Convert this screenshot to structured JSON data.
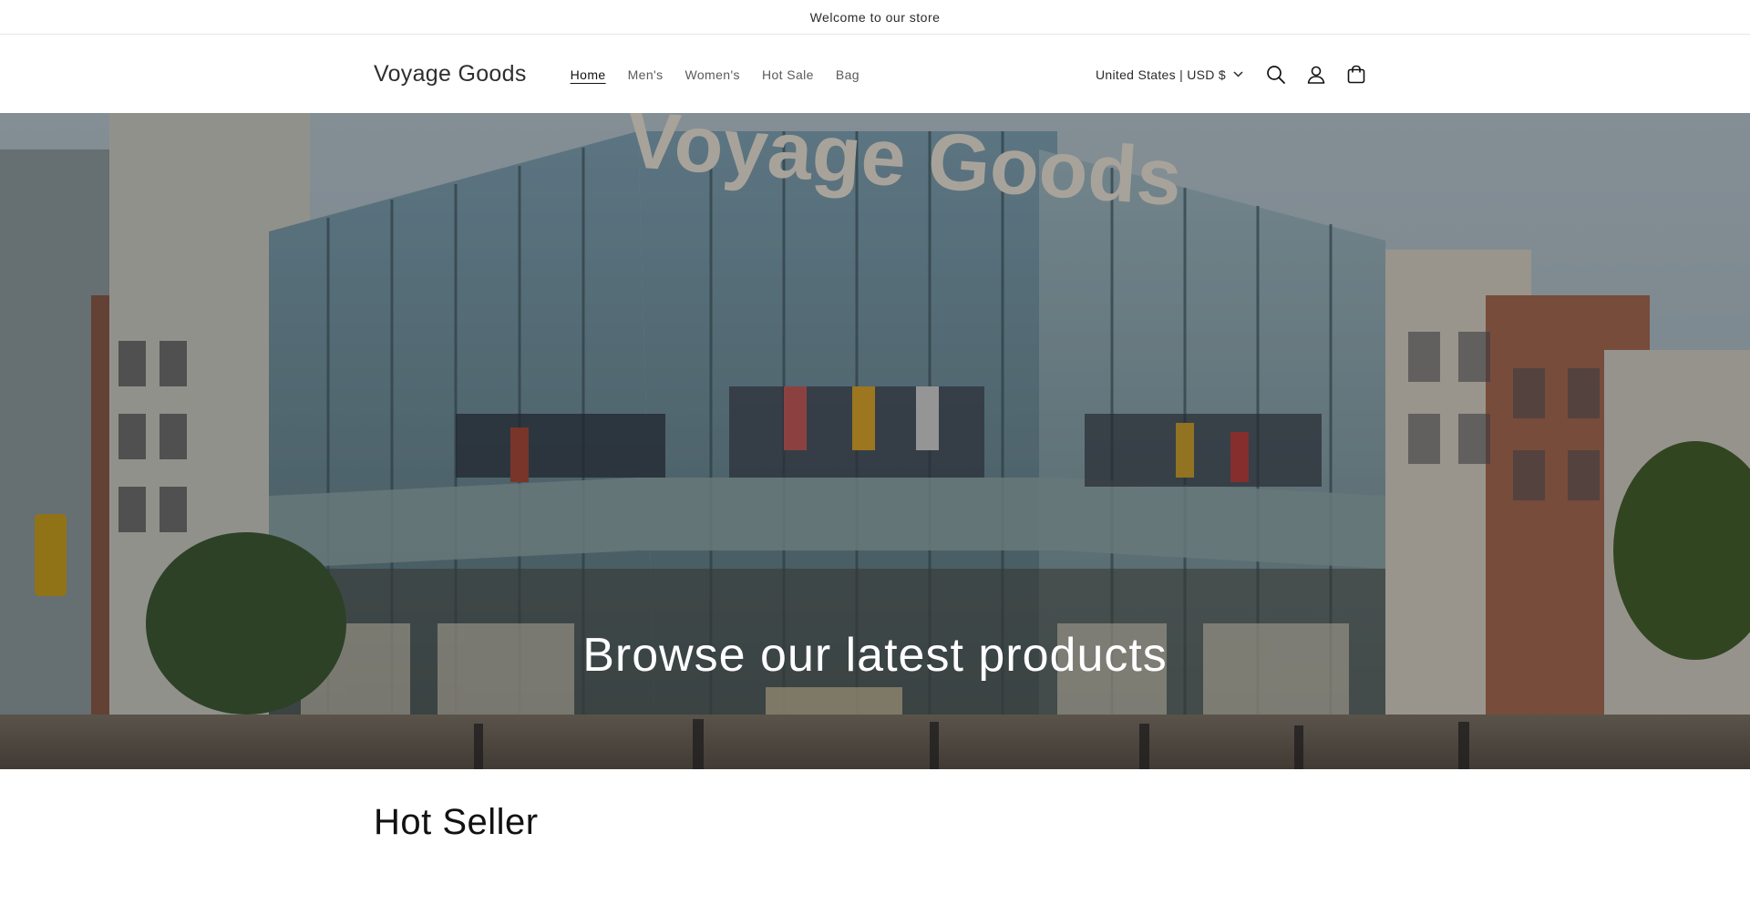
{
  "announcement": {
    "text": "Welcome to our store"
  },
  "header": {
    "logo": "Voyage Goods",
    "nav": [
      {
        "label": "Home",
        "active": true
      },
      {
        "label": "Men's",
        "active": false
      },
      {
        "label": "Women's",
        "active": false
      },
      {
        "label": "Hot Sale",
        "active": false
      },
      {
        "label": "Bag",
        "active": false
      }
    ],
    "locale": "United States | USD $",
    "icons": [
      "search-icon",
      "account-icon",
      "cart-icon",
      "chevron-down-icon"
    ]
  },
  "hero": {
    "title": "Browse our latest products",
    "sign_text": "Voyage Goods"
  },
  "hot_seller": {
    "title": "Hot Seller"
  },
  "colors": {
    "text": "#121212",
    "nav_muted": "#5a5a5a",
    "border": "#e6e6e6",
    "hero_text": "#ffffff"
  }
}
